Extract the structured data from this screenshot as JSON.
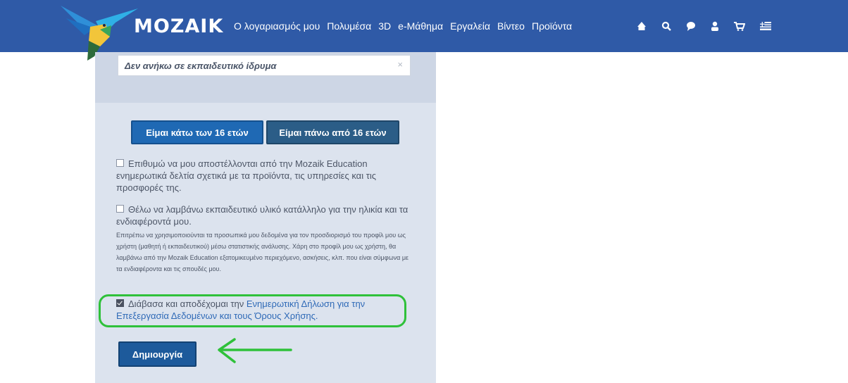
{
  "header": {
    "logo": "MOZAIK",
    "nav": [
      "Ο λογαριασμός μου",
      "Πολυμέσα",
      "3D",
      "e-Μάθημα",
      "Εργαλεία",
      "Βίντεο",
      "Προϊόντα"
    ],
    "icons": [
      "home-icon",
      "search-icon",
      "chat-icon",
      "user-icon",
      "cart-icon",
      "language-flag-icon"
    ]
  },
  "form": {
    "institution_value": "Δεν ανήκω σε εκπαιδευτικό ίδρυμα",
    "institution_clear": "×",
    "age_under_label": "Είμαι κάτω των 16 ετών",
    "age_over_label": "Είμαι πάνω από 16 ετών",
    "newsletter_label": "Επιθυμώ να μου αποστέλλονται από την Mozaik Education ενημερωτικά δελτία σχετικά με τα προϊόντα, τις υπηρεσίες και τις προσφορές της.",
    "newsletter_checked": false,
    "personalized_label": "Θέλω να λαμβάνω εκπαιδευτικό υλικό κατάλληλο για την ηλικία και τα ενδιαφέροντά μου.",
    "personalized_checked": false,
    "personalized_note": "Επιτρέπω να χρησιμοποιούνται τα προσωπικά μου δεδομένα για τον προσδιορισμό του προφίλ μου ως χρήστη (μαθητή ή εκπαιδευτικού) μέσω στατιστικής ανάλυσης. Χάρη στο προφίλ μου ως χρήστη, θα λαμβάνω από την Mozaik Education εξατομικευμένο περιεχόμενο, ασκήσεις, κλπ. που είναι σύμφωνα με τα ενδιαφέροντα και τις σπουδές μου.",
    "terms_prefix": "Διάβασα και αποδέχομαι την",
    "terms_link1": "Ενημερωτική Δήλωση για την Επεξεργασία Δεδομένων",
    "terms_and": "και τους",
    "terms_link2": "Όρους Χρήσης",
    "terms_suffix": ".",
    "terms_checked": true,
    "create_label": "Δημιουργία"
  },
  "colors": {
    "header_bg": "#2f5aa7",
    "panel_bg": "#dce3ee",
    "button_blue": "#1f69b4",
    "button_dark": "#2b5d87",
    "highlight_green": "#2fc13a"
  }
}
